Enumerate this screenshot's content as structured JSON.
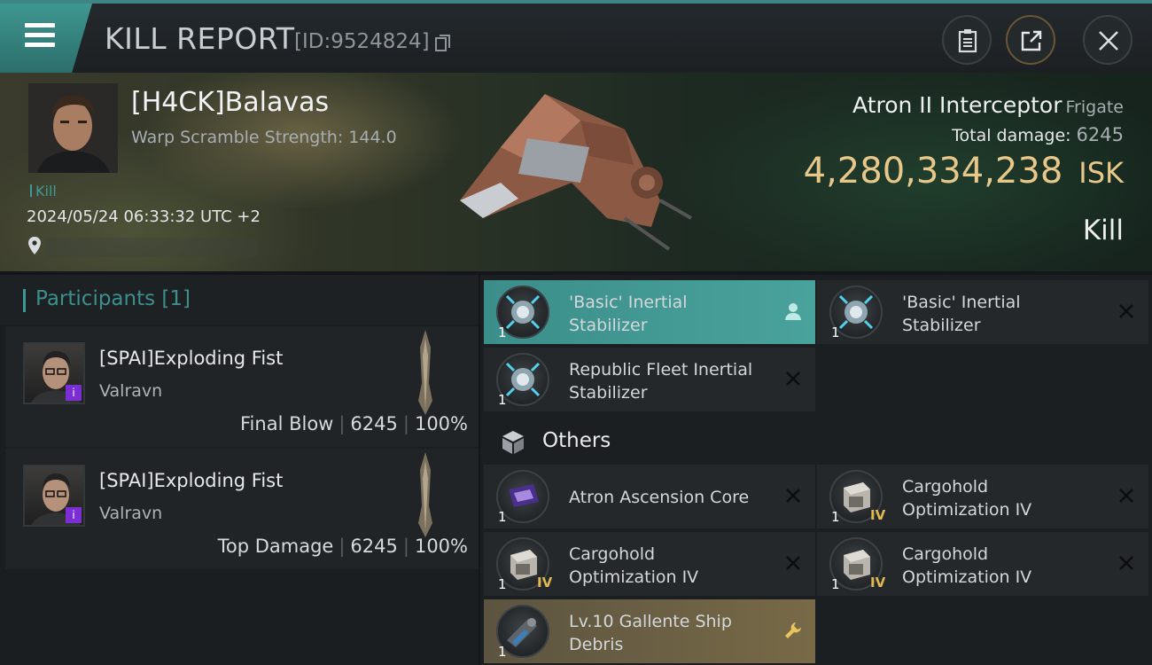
{
  "header": {
    "title": "KILL REPORT",
    "report_id": "[ID:9524824]"
  },
  "victim": {
    "name": "[H4CK]Balavas",
    "warp_scramble": "Warp Scramble Strength: 144.0",
    "tag": "Kill",
    "datetime": "2024/05/24 06:33:32 UTC +2"
  },
  "ship": {
    "name": "Atron II Interceptor",
    "class": "Frigate",
    "total_damage_label": "Total damage:",
    "total_damage": "6245",
    "isk_value": "4,280,334,238",
    "isk_unit": "ISK",
    "result": "Kill"
  },
  "participants": {
    "title": "Participants [1]",
    "rows": [
      {
        "name": "[SPAI]Exploding Fist",
        "ship": "Valravn",
        "role": "Final Blow",
        "damage": "6245",
        "percent": "100%"
      },
      {
        "name": "[SPAI]Exploding Fist",
        "ship": "Valravn",
        "role": "Top Damage",
        "damage": "6245",
        "percent": "100%"
      }
    ]
  },
  "items": {
    "modules": [
      {
        "line1": "'Basic' Inertial",
        "line2": "Stabilizer",
        "qty": "1",
        "state": "looted"
      },
      {
        "line1": "'Basic' Inertial",
        "line2": "Stabilizer",
        "qty": "1",
        "state": "destroyed"
      },
      {
        "line1": "Republic Fleet Inertial",
        "line2": "Stabilizer",
        "qty": "1",
        "state": "destroyed"
      }
    ],
    "others_label": "Others",
    "others": [
      {
        "line1": "Atron Ascension Core",
        "line2": "",
        "qty": "1",
        "level": "",
        "state": "destroyed"
      },
      {
        "line1": "Cargohold",
        "line2": "Optimization IV",
        "qty": "1",
        "level": "IV",
        "state": "destroyed"
      },
      {
        "line1": "Cargohold",
        "line2": "Optimization IV",
        "qty": "1",
        "level": "IV",
        "state": "destroyed"
      },
      {
        "line1": "Cargohold",
        "line2": "Optimization IV",
        "qty": "1",
        "level": "IV",
        "state": "destroyed"
      },
      {
        "line1": "Lv.10 Gallente Ship",
        "line2": "Debris",
        "qty": "1",
        "level": "",
        "state": "salvage"
      }
    ]
  },
  "colors": {
    "accent": "#3d9a96",
    "isk": "#e7c88a",
    "highlight": "#4aa29c",
    "salvage": "#786a47"
  }
}
